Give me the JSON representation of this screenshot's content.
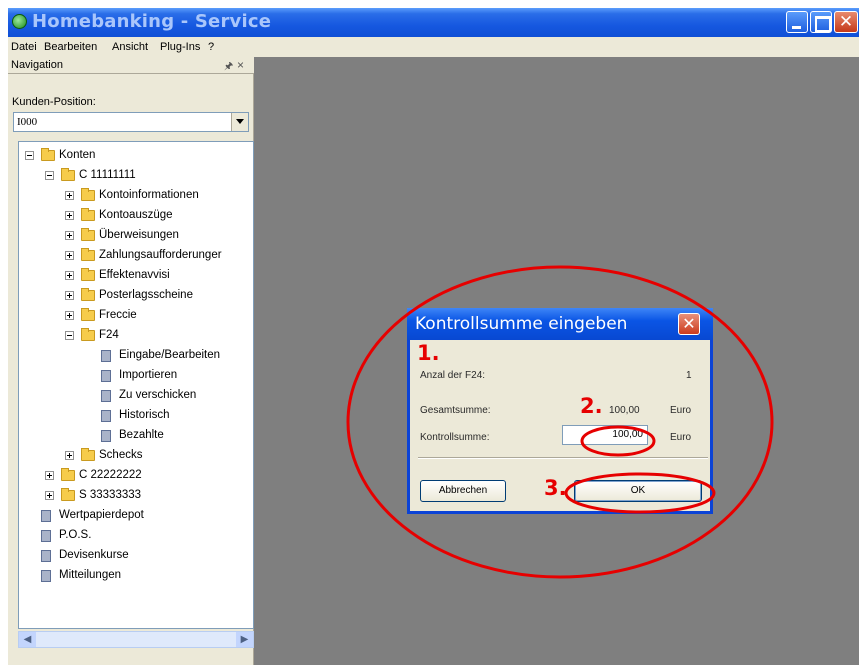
{
  "window": {
    "title": "Homebanking - Service",
    "icon": "globe-icon"
  },
  "menubar": {
    "items": [
      "Datei",
      "Bearbeiten",
      "Ansicht",
      "Plug-Ins",
      "?"
    ]
  },
  "navigation": {
    "title": "Navigation",
    "pin_icon": "pin-icon",
    "close_glyph": "×",
    "kunden_label": "Kunden-Position:",
    "kunden_value": "I000",
    "tree": [
      {
        "label": "Konten",
        "type": "folder",
        "expander": "minus"
      },
      {
        "label": "C 11111111",
        "type": "folder",
        "expander": "minus"
      },
      {
        "label": "Kontoinformationen",
        "type": "folder",
        "expander": "plus"
      },
      {
        "label": "Kontoauszüge",
        "type": "folder",
        "expander": "plus"
      },
      {
        "label": "Überweisungen",
        "type": "folder",
        "expander": "plus"
      },
      {
        "label": "Zahlungsaufforderunger",
        "type": "folder",
        "expander": "plus"
      },
      {
        "label": "Effektenavvisi",
        "type": "folder",
        "expander": "plus"
      },
      {
        "label": "Posterlagsscheine",
        "type": "folder",
        "expander": "plus"
      },
      {
        "label": "Freccie",
        "type": "folder",
        "expander": "plus"
      },
      {
        "label": "F24",
        "type": "folder",
        "expander": "minus"
      },
      {
        "label": "Eingabe/Bearbeiten",
        "type": "doc"
      },
      {
        "label": "Importieren",
        "type": "doc"
      },
      {
        "label": "Zu verschicken",
        "type": "doc"
      },
      {
        "label": "Historisch",
        "type": "doc"
      },
      {
        "label": "Bezahlte",
        "type": "doc"
      },
      {
        "label": "Schecks",
        "type": "folder",
        "expander": "plus"
      },
      {
        "label": "C 22222222",
        "type": "folder",
        "expander": "plus"
      },
      {
        "label": "S 33333333",
        "type": "folder",
        "expander": "plus"
      },
      {
        "label": "Wertpapierdepot",
        "type": "doc"
      },
      {
        "label": "P.O.S.",
        "type": "doc"
      },
      {
        "label": "Devisenkurse",
        "type": "doc"
      },
      {
        "label": "Mitteilungen",
        "type": "doc"
      }
    ]
  },
  "dialog": {
    "title": "Kontrollsumme eingeben",
    "close_glyph": "✕",
    "anzahl_label": "Anzal der F24:",
    "anzahl_value": "1",
    "gesamt_label": "Gesamtsumme:",
    "gesamt_value": "100,00",
    "gesamt_unit": "Euro",
    "kontroll_label": "Kontrollsumme:",
    "kontroll_value": "100,00",
    "kontroll_unit": "Euro",
    "cancel_label": "Abbrechen",
    "ok_label": "OK"
  },
  "annotations": {
    "step1": "1.",
    "step2": "2.",
    "step3": "3.",
    "color": "#e60000"
  },
  "colors": {
    "titlebar": "#1658e0",
    "workspace": "#7f7f7f",
    "panel": "#ece9d8"
  }
}
